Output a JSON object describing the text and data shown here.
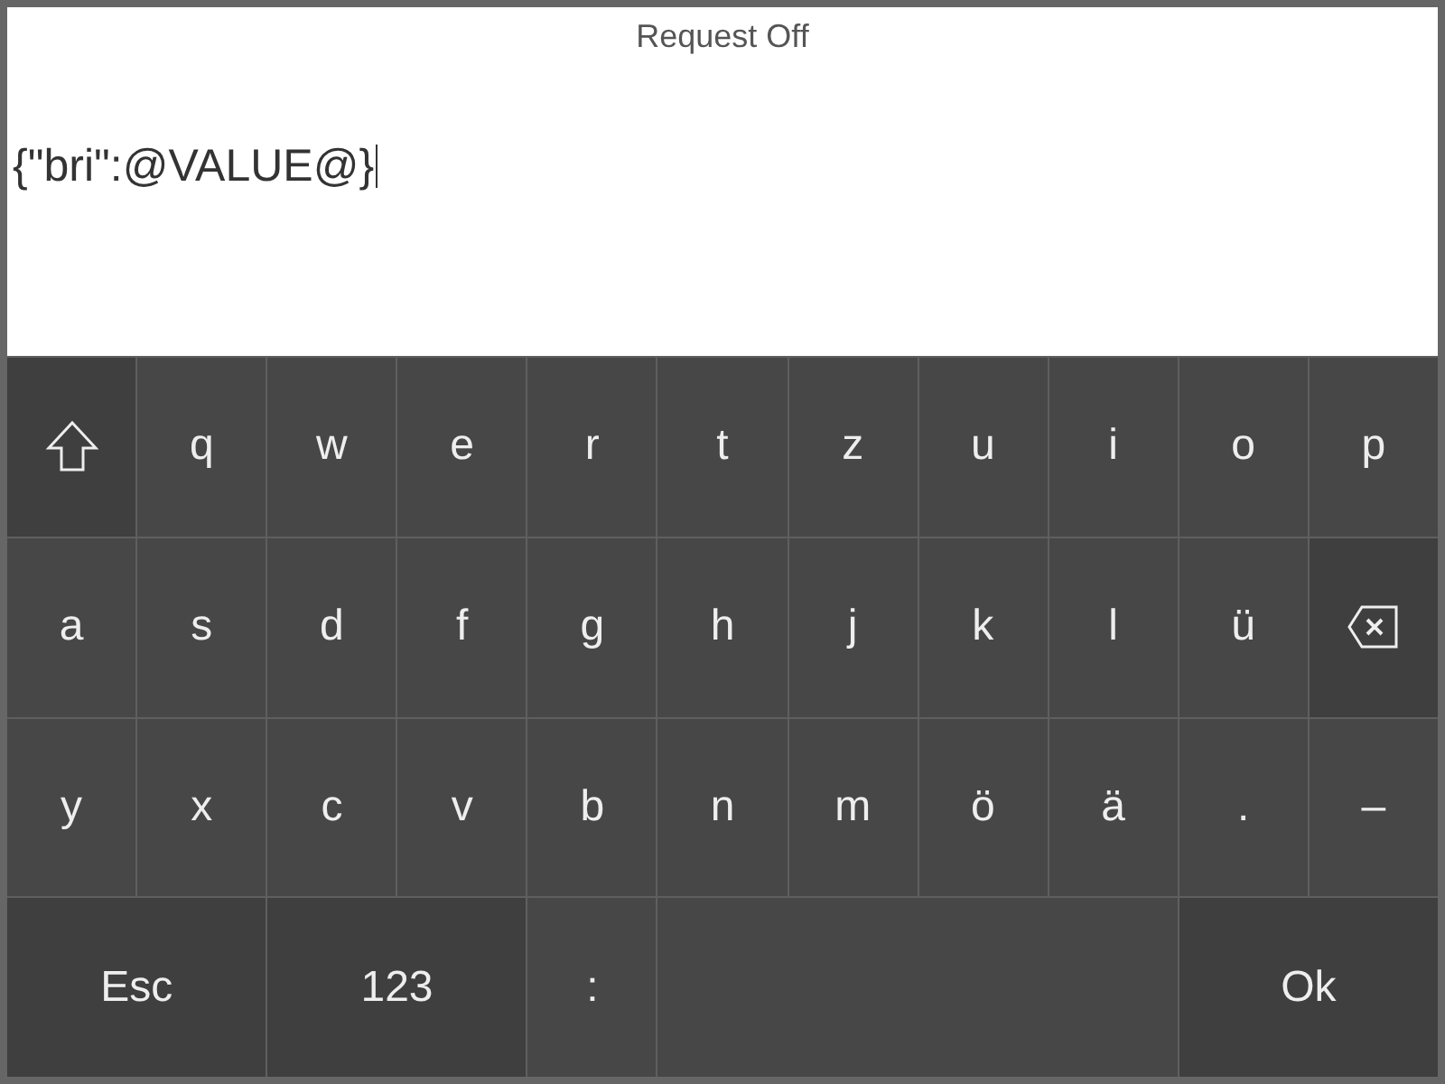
{
  "title": "Request Off",
  "input": {
    "value": "{\"bri\":@VALUE@}"
  },
  "keyboard": {
    "rows": [
      [
        {
          "kind": "shift"
        },
        {
          "kind": "char",
          "label": "q"
        },
        {
          "kind": "char",
          "label": "w"
        },
        {
          "kind": "char",
          "label": "e"
        },
        {
          "kind": "char",
          "label": "r"
        },
        {
          "kind": "char",
          "label": "t"
        },
        {
          "kind": "char",
          "label": "z"
        },
        {
          "kind": "char",
          "label": "u"
        },
        {
          "kind": "char",
          "label": "i"
        },
        {
          "kind": "char",
          "label": "o"
        },
        {
          "kind": "char",
          "label": "p"
        }
      ],
      [
        {
          "kind": "char",
          "label": "a"
        },
        {
          "kind": "char",
          "label": "s"
        },
        {
          "kind": "char",
          "label": "d"
        },
        {
          "kind": "char",
          "label": "f"
        },
        {
          "kind": "char",
          "label": "g"
        },
        {
          "kind": "char",
          "label": "h"
        },
        {
          "kind": "char",
          "label": "j"
        },
        {
          "kind": "char",
          "label": "k"
        },
        {
          "kind": "char",
          "label": "l"
        },
        {
          "kind": "char",
          "label": "ü"
        },
        {
          "kind": "backspace"
        }
      ],
      [
        {
          "kind": "char",
          "label": "y"
        },
        {
          "kind": "char",
          "label": "x"
        },
        {
          "kind": "char",
          "label": "c"
        },
        {
          "kind": "char",
          "label": "v"
        },
        {
          "kind": "char",
          "label": "b"
        },
        {
          "kind": "char",
          "label": "n"
        },
        {
          "kind": "char",
          "label": "m"
        },
        {
          "kind": "char",
          "label": "ö"
        },
        {
          "kind": "char",
          "label": "ä"
        },
        {
          "kind": "char",
          "label": "."
        },
        {
          "kind": "char",
          "label": "–"
        }
      ],
      [
        {
          "kind": "function",
          "label": "Esc",
          "colspan": 2
        },
        {
          "kind": "function",
          "label": "123",
          "colspan": 2
        },
        {
          "kind": "char",
          "label": ":"
        },
        {
          "kind": "space",
          "colspan": 4
        },
        {
          "kind": "function",
          "label": "Ok",
          "colspan": 2
        }
      ]
    ]
  }
}
